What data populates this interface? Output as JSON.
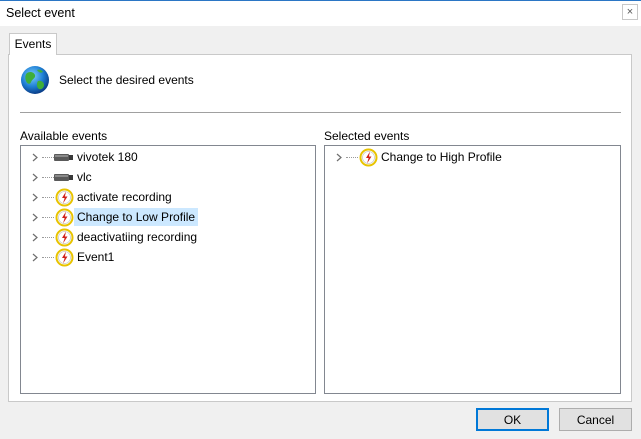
{
  "window": {
    "title": "Select event",
    "close_glyph": "×"
  },
  "tabs": [
    {
      "label": "Events",
      "active": true
    }
  ],
  "panel": {
    "icon": "globe-icon",
    "instruction": "Select the desired events"
  },
  "available": {
    "label": "Available events",
    "items": [
      {
        "label": "vivotek 180",
        "icon": "camera-icon",
        "selected": false
      },
      {
        "label": "vlc",
        "icon": "camera-icon",
        "selected": false
      },
      {
        "label": "activate recording",
        "icon": "event-lightning-icon",
        "selected": false
      },
      {
        "label": "Change to Low Profile",
        "icon": "event-lightning-icon",
        "selected": true
      },
      {
        "label": "deactivatiing recording",
        "icon": "event-lightning-icon",
        "selected": false
      },
      {
        "label": "Event1",
        "icon": "event-lightning-icon",
        "selected": false
      }
    ]
  },
  "selected": {
    "label": "Selected events",
    "items": [
      {
        "label": "Change to High Profile",
        "icon": "event-lightning-icon",
        "selected": false
      }
    ]
  },
  "buttons": {
    "ok": "OK",
    "cancel": "Cancel"
  },
  "colors": {
    "accent": "#0078d7",
    "selection": "#cce8ff",
    "event_ring": "#e8c300",
    "event_bolt": "#d0201a"
  }
}
